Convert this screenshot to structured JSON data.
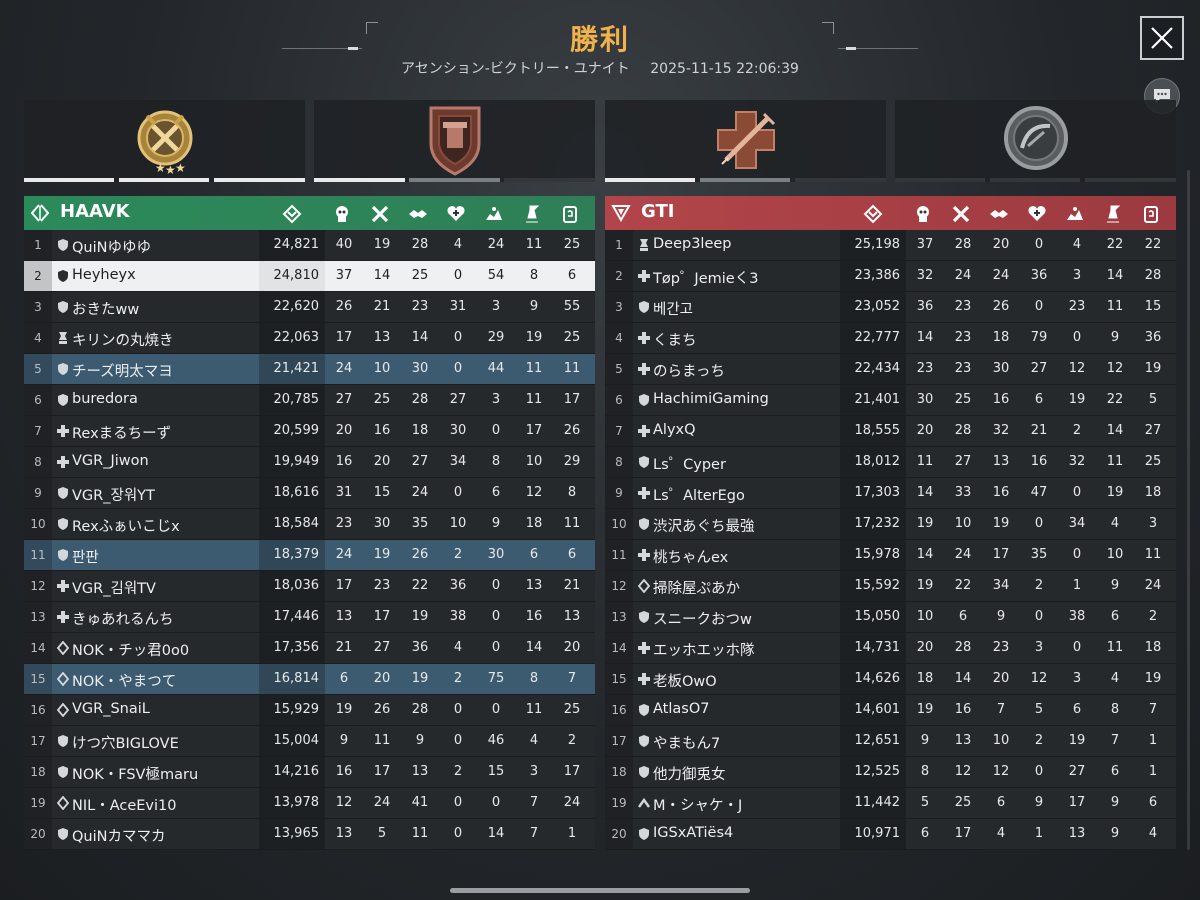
{
  "header": {
    "title": "勝利",
    "mode": "アセンション-ビクトリー・ユナイト",
    "datetime": "2025-11-15 22:06:39"
  },
  "awards": [
    {
      "icon": "medal-stars-icon",
      "color": "#c9a24a"
    },
    {
      "icon": "armor-shield-icon",
      "color": "#8a4a3a"
    },
    {
      "icon": "medic-syringe-icon",
      "color": "#9a5a44"
    },
    {
      "icon": "radar-dish-icon",
      "color": "#8d8f91"
    }
  ],
  "stat_icons": [
    "score-icon",
    "kills-icon",
    "deaths-icon",
    "assists-icon",
    "heal-icon",
    "capture-icon",
    "objective-icon",
    "revive-icon"
  ],
  "teams": [
    {
      "name": "HAAVK",
      "color": "#2b8a5a",
      "players": [
        {
          "rank": "1",
          "badge": "shield",
          "name": "QuiNゆゆゆ",
          "score": "24,821",
          "stats": [
            "40",
            "19",
            "28",
            "4",
            "24",
            "11",
            "25"
          ]
        },
        {
          "rank": "2",
          "badge": "shield",
          "name": "Heyheyx",
          "score": "24,810",
          "stats": [
            "37",
            "14",
            "25",
            "0",
            "54",
            "8",
            "6"
          ],
          "me": true
        },
        {
          "rank": "3",
          "badge": "shield",
          "name": "おきたww",
          "score": "22,620",
          "stats": [
            "26",
            "21",
            "23",
            "31",
            "3",
            "9",
            "55"
          ]
        },
        {
          "rank": "4",
          "badge": "lock",
          "name": "キリンの丸焼き",
          "score": "22,063",
          "stats": [
            "17",
            "13",
            "14",
            "0",
            "29",
            "19",
            "25"
          ]
        },
        {
          "rank": "5",
          "badge": "shield",
          "name": "チーズ明太マヨ",
          "score": "21,421",
          "stats": [
            "24",
            "10",
            "30",
            "0",
            "44",
            "11",
            "11"
          ],
          "hl": true
        },
        {
          "rank": "6",
          "badge": "shield",
          "name": "buredora",
          "score": "20,785",
          "stats": [
            "27",
            "25",
            "28",
            "27",
            "3",
            "11",
            "17"
          ]
        },
        {
          "rank": "7",
          "badge": "plus",
          "name": "Rexまるちーず",
          "score": "20,599",
          "stats": [
            "20",
            "16",
            "18",
            "30",
            "0",
            "17",
            "26"
          ]
        },
        {
          "rank": "8",
          "badge": "plus",
          "name": "VGR_Jiwon",
          "score": "19,949",
          "stats": [
            "16",
            "20",
            "27",
            "34",
            "8",
            "10",
            "29"
          ]
        },
        {
          "rank": "9",
          "badge": "shield",
          "name": "VGR_장워YT",
          "score": "18,616",
          "stats": [
            "31",
            "15",
            "24",
            "0",
            "6",
            "12",
            "8"
          ]
        },
        {
          "rank": "10",
          "badge": "shield",
          "name": "Rexふぁいこじx",
          "score": "18,584",
          "stats": [
            "23",
            "30",
            "35",
            "10",
            "9",
            "18",
            "11"
          ]
        },
        {
          "rank": "11",
          "badge": "shield",
          "name": "판판",
          "score": "18,379",
          "stats": [
            "24",
            "19",
            "26",
            "2",
            "30",
            "6",
            "6"
          ],
          "hl": true
        },
        {
          "rank": "12",
          "badge": "plus",
          "name": "VGR_김워TV",
          "score": "18,036",
          "stats": [
            "17",
            "23",
            "22",
            "36",
            "0",
            "13",
            "21"
          ]
        },
        {
          "rank": "13",
          "badge": "plus",
          "name": "きゅあれるんち",
          "score": "17,446",
          "stats": [
            "13",
            "17",
            "19",
            "38",
            "0",
            "16",
            "13"
          ]
        },
        {
          "rank": "14",
          "badge": "diamond",
          "name": "NOK・チッ君0o0",
          "score": "17,356",
          "stats": [
            "21",
            "27",
            "36",
            "4",
            "0",
            "14",
            "20"
          ]
        },
        {
          "rank": "15",
          "badge": "diamond",
          "name": "NOK・やまつて",
          "score": "16,814",
          "stats": [
            "6",
            "20",
            "19",
            "2",
            "75",
            "8",
            "7"
          ],
          "hl": true
        },
        {
          "rank": "16",
          "badge": "diamond",
          "name": "VGR_SnaiL",
          "score": "15,929",
          "stats": [
            "19",
            "26",
            "28",
            "0",
            "0",
            "11",
            "25"
          ]
        },
        {
          "rank": "17",
          "badge": "shield",
          "name": "けつ穴BIGLOVE",
          "score": "15,004",
          "stats": [
            "9",
            "11",
            "9",
            "0",
            "46",
            "4",
            "2"
          ]
        },
        {
          "rank": "18",
          "badge": "shield",
          "name": "NOK・FSV極maru",
          "score": "14,216",
          "stats": [
            "16",
            "17",
            "13",
            "2",
            "15",
            "3",
            "17"
          ]
        },
        {
          "rank": "19",
          "badge": "diamond",
          "name": "NIL・AceEvi10",
          "score": "13,978",
          "stats": [
            "12",
            "24",
            "41",
            "0",
            "0",
            "7",
            "24"
          ]
        },
        {
          "rank": "20",
          "badge": "shield",
          "name": "QuiNカママカ",
          "score": "13,965",
          "stats": [
            "13",
            "5",
            "11",
            "0",
            "14",
            "7",
            "1"
          ]
        }
      ]
    },
    {
      "name": "GTI",
      "color": "#b2454a",
      "players": [
        {
          "rank": "1",
          "badge": "lock",
          "name": "Deep3leep",
          "score": "25,198",
          "stats": [
            "37",
            "28",
            "20",
            "0",
            "4",
            "22",
            "22"
          ]
        },
        {
          "rank": "2",
          "badge": "plus",
          "name": "Tøp゜Jemieく3",
          "score": "23,386",
          "stats": [
            "32",
            "24",
            "24",
            "36",
            "3",
            "14",
            "28"
          ]
        },
        {
          "rank": "3",
          "badge": "shield",
          "name": "베간고",
          "score": "23,052",
          "stats": [
            "36",
            "23",
            "26",
            "0",
            "23",
            "11",
            "15"
          ]
        },
        {
          "rank": "4",
          "badge": "plus",
          "name": "くまち",
          "score": "22,777",
          "stats": [
            "14",
            "23",
            "18",
            "79",
            "0",
            "9",
            "36"
          ]
        },
        {
          "rank": "5",
          "badge": "plus",
          "name": "のらまっち",
          "score": "22,434",
          "stats": [
            "23",
            "23",
            "30",
            "27",
            "12",
            "12",
            "19"
          ]
        },
        {
          "rank": "6",
          "badge": "shield",
          "name": "HachimiGaming",
          "score": "21,401",
          "stats": [
            "30",
            "25",
            "16",
            "6",
            "19",
            "22",
            "5"
          ]
        },
        {
          "rank": "7",
          "badge": "plus",
          "name": "AlyxQ",
          "score": "18,555",
          "stats": [
            "20",
            "28",
            "32",
            "21",
            "2",
            "14",
            "27"
          ]
        },
        {
          "rank": "8",
          "badge": "shield",
          "name": "Ls゜Cyper",
          "score": "18,012",
          "stats": [
            "11",
            "27",
            "13",
            "16",
            "32",
            "11",
            "25"
          ]
        },
        {
          "rank": "9",
          "badge": "plus",
          "name": "Ls゜AlterEgo",
          "score": "17,303",
          "stats": [
            "14",
            "33",
            "16",
            "47",
            "0",
            "19",
            "18"
          ]
        },
        {
          "rank": "10",
          "badge": "shield",
          "name": "渋沢あぐち最強",
          "score": "17,232",
          "stats": [
            "19",
            "10",
            "19",
            "0",
            "34",
            "4",
            "3"
          ]
        },
        {
          "rank": "11",
          "badge": "plus",
          "name": "桃ちゃんex",
          "score": "15,978",
          "stats": [
            "14",
            "24",
            "17",
            "35",
            "0",
            "10",
            "11"
          ]
        },
        {
          "rank": "12",
          "badge": "diamond",
          "name": "掃除屋ぷあか",
          "score": "15,592",
          "stats": [
            "19",
            "22",
            "34",
            "2",
            "1",
            "9",
            "24"
          ]
        },
        {
          "rank": "13",
          "badge": "shield",
          "name": "スニークおつw",
          "score": "15,050",
          "stats": [
            "10",
            "6",
            "9",
            "0",
            "38",
            "6",
            "2"
          ]
        },
        {
          "rank": "14",
          "badge": "plus",
          "name": "エッホエッホ隊",
          "score": "14,731",
          "stats": [
            "20",
            "28",
            "23",
            "3",
            "0",
            "11",
            "18"
          ]
        },
        {
          "rank": "15",
          "badge": "plus",
          "name": "老板OwO",
          "score": "14,626",
          "stats": [
            "18",
            "14",
            "20",
            "12",
            "3",
            "4",
            "19"
          ]
        },
        {
          "rank": "16",
          "badge": "shield",
          "name": "AtlasO7",
          "score": "14,601",
          "stats": [
            "19",
            "16",
            "7",
            "5",
            "6",
            "8",
            "7"
          ]
        },
        {
          "rank": "17",
          "badge": "shield",
          "name": "やまもん7",
          "score": "12,651",
          "stats": [
            "9",
            "13",
            "10",
            "2",
            "19",
            "7",
            "1"
          ]
        },
        {
          "rank": "18",
          "badge": "shield",
          "name": "他力御兎女",
          "score": "12,525",
          "stats": [
            "8",
            "12",
            "12",
            "0",
            "27",
            "6",
            "1"
          ]
        },
        {
          "rank": "19",
          "badge": "chevron",
          "name": "M・シャケ・J",
          "score": "11,442",
          "stats": [
            "5",
            "25",
            "6",
            "9",
            "17",
            "9",
            "6"
          ]
        },
        {
          "rank": "20",
          "badge": "shield",
          "name": "IGSxATiës4",
          "score": "10,971",
          "stats": [
            "6",
            "17",
            "4",
            "1",
            "13",
            "9",
            "4"
          ]
        }
      ]
    }
  ]
}
